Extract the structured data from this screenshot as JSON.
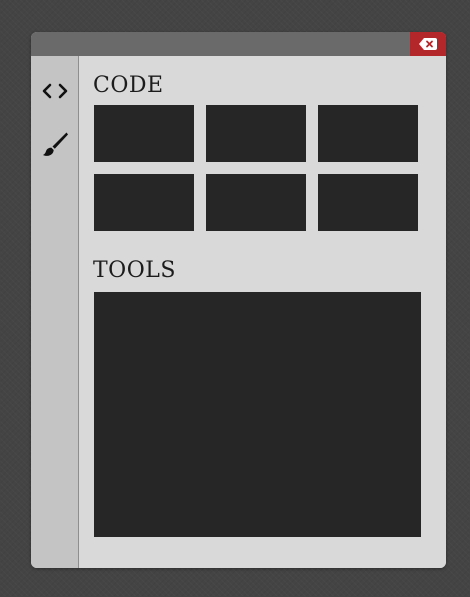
{
  "window": {
    "titlebar_color": "#6a6a6a",
    "close_button_color": "#b3262a"
  },
  "sidebar": {
    "items": [
      {
        "icon": "code-brackets-icon",
        "glyph": "<>"
      },
      {
        "icon": "paintbrush-icon"
      }
    ]
  },
  "code_section": {
    "title": "CODE",
    "tile_count": 6
  },
  "tools_section": {
    "title": "TOOLS"
  },
  "colors": {
    "panel_bg": "#d9d9d9",
    "sidebar_bg": "#c4c4c4",
    "tile_bg": "#262626",
    "desktop_bg": "#444444"
  }
}
